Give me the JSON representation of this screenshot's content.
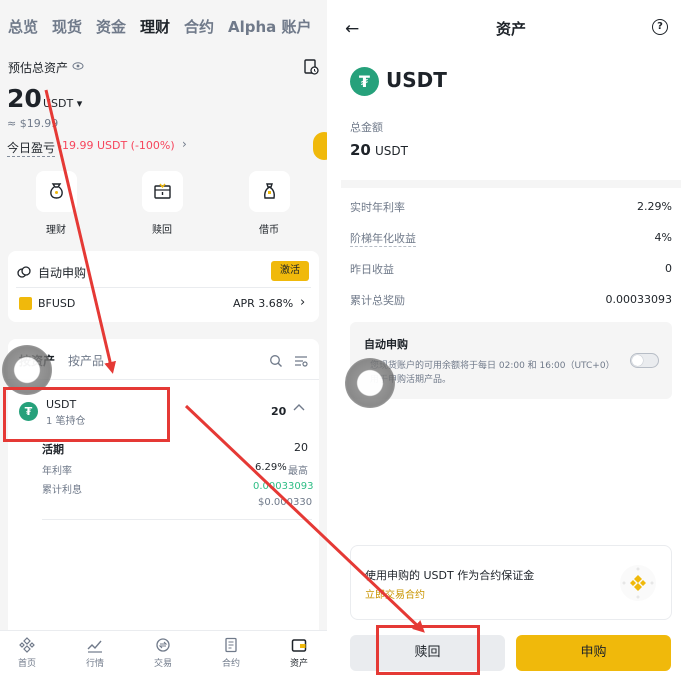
{
  "left": {
    "topnav": [
      "总览",
      "现货",
      "资金",
      "理财",
      "合约",
      "Alpha 账户"
    ],
    "active_tab": "理财",
    "est_label": "预估总资产",
    "total_amount": "20",
    "total_currency": "USDT ▾",
    "approx_value": "≈ $19.99",
    "pnl_label": "今日盈亏",
    "pnl_value": "-19.99 USDT (-100%)",
    "quick_actions": [
      "理财",
      "赎回",
      "借币"
    ],
    "auto_subscribe": {
      "title": "自动申购",
      "activate_label": "激活",
      "product_name": "BFUSD",
      "apr_text": "APR 3.68%"
    },
    "tabs": {
      "by_asset": "按资产",
      "by_product": "按产品"
    },
    "asset_row": {
      "name": "USDT",
      "sub": "1 笔持仓",
      "amount": "20"
    },
    "flexible": {
      "title": "活期",
      "amount": "20",
      "apr_label": "年利率",
      "apr_value": "6.29%",
      "apr_suffix": "最高",
      "interest_label": "累计利息",
      "interest_value": "0.00033093",
      "interest_usd": "$0.000330"
    },
    "bottom_nav": [
      "首页",
      "行情",
      "交易",
      "合约",
      "资产"
    ],
    "bottom_nav_active": "资产"
  },
  "right": {
    "title": "资产",
    "coin_name": "USDT",
    "total_label": "总金额",
    "total_value": "20",
    "total_currency": "USDT",
    "rows": [
      {
        "label": "实时年利率",
        "value": "2.29%"
      },
      {
        "label": "阶梯年化收益",
        "value": "4%"
      },
      {
        "label": "昨日收益",
        "value": "0"
      },
      {
        "label": "累计总奖励",
        "value": "0.00033093"
      }
    ],
    "auto_subscribe": {
      "title": "自动申购",
      "desc": "您现货账户的可用余额将于每日 02:00 和 16:00（UTC+0）用于申购活期产品。",
      "enabled": false
    },
    "promo": {
      "text": "使用申购的 USDT 作为合约保证金",
      "link": "立即交易合约"
    },
    "redeem_label": "赎回",
    "subscribe_label": "申购"
  },
  "colors": {
    "brand_yellow": "#f0b90b",
    "loss_red": "#f6465d",
    "profit_green": "#2ebd85",
    "tether_green": "#26a17b",
    "annotation_red": "#e53935"
  }
}
